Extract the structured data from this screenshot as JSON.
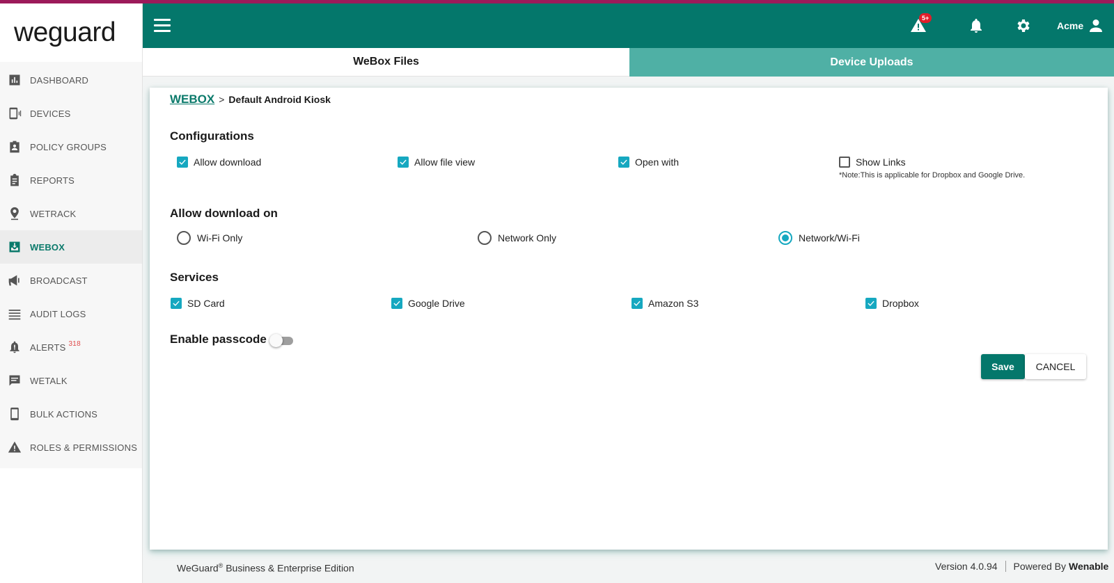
{
  "app": {
    "logo_text": "weguard"
  },
  "sidebar": {
    "items": [
      {
        "label": "DASHBOARD",
        "icon": "bar-chart-icon"
      },
      {
        "label": "DEVICES",
        "icon": "device-icon"
      },
      {
        "label": "POLICY GROUPS",
        "icon": "badge-icon"
      },
      {
        "label": "REPORTS",
        "icon": "clipboard-icon"
      },
      {
        "label": "WETRACK",
        "icon": "location-pin-icon"
      },
      {
        "label": "WEBOX",
        "icon": "inbox-icon",
        "active": true
      },
      {
        "label": "BROADCAST",
        "icon": "megaphone-icon"
      },
      {
        "label": "AUDIT LOGS",
        "icon": "list-icon"
      },
      {
        "label": "ALERTS",
        "icon": "bell-icon",
        "badge": "318"
      },
      {
        "label": "WETALK",
        "icon": "chat-icon"
      },
      {
        "label": "BULK ACTIONS",
        "icon": "phone-icon"
      },
      {
        "label": "ROLES & PERMISSIONS",
        "icon": "warning-icon"
      }
    ]
  },
  "header": {
    "alert_badge": "5+",
    "user_name": "Acme"
  },
  "tabs": [
    {
      "label": "WeBox Files",
      "active": true
    },
    {
      "label": "Device Uploads",
      "active": false
    }
  ],
  "breadcrumb": {
    "root": "WEBOX",
    "separator": ">",
    "current": "Default Android Kiosk"
  },
  "configurations": {
    "title": "Configurations",
    "options": [
      {
        "label": "Allow download",
        "checked": true
      },
      {
        "label": "Allow file view",
        "checked": true
      },
      {
        "label": "Open with",
        "checked": true
      },
      {
        "label": "Show Links",
        "checked": false
      }
    ],
    "note": "*Note:This is applicable for Dropbox and Google Drive."
  },
  "allow_download_on": {
    "title": "Allow download on",
    "options": [
      {
        "label": "Wi-Fi Only",
        "selected": false
      },
      {
        "label": "Network Only",
        "selected": false
      },
      {
        "label": "Network/Wi-Fi",
        "selected": true
      }
    ]
  },
  "services": {
    "title": "Services",
    "options": [
      {
        "label": "SD Card",
        "checked": true
      },
      {
        "label": "Google Drive",
        "checked": true
      },
      {
        "label": "Amazon S3",
        "checked": true
      },
      {
        "label": "Dropbox",
        "checked": true
      }
    ]
  },
  "passcode": {
    "label": "Enable passcode",
    "enabled": false
  },
  "actions": {
    "save": "Save",
    "cancel": "CANCEL"
  },
  "footer": {
    "brand": "WeGuard",
    "reg": "®",
    "edition": " Business & Enterprise Edition",
    "version": "Version 4.0.94",
    "powered_by": "Powered By",
    "powered_name": "Wenable"
  },
  "colors": {
    "header": "#04776b",
    "accent": "#16a8c0",
    "tab_inactive": "#4fb0a5",
    "alert_badge": "#e01e2a"
  }
}
